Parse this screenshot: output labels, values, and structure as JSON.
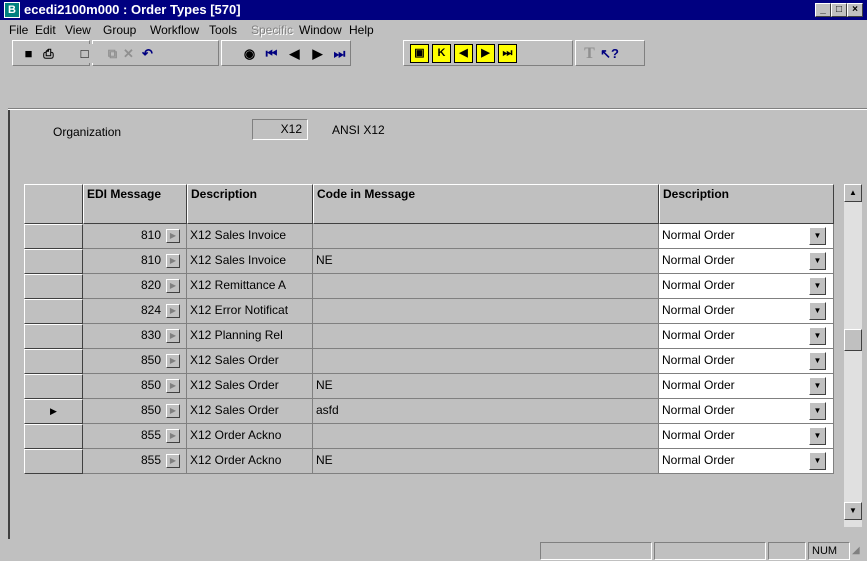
{
  "window": {
    "title": "ecedi2100m000 : Order Types [570]",
    "app_icon": "B",
    "controls": [
      "_",
      "□",
      "×"
    ]
  },
  "menu": [
    {
      "label": "File",
      "disabled": false
    },
    {
      "label": "Edit",
      "disabled": false
    },
    {
      "label": "View",
      "disabled": false
    },
    {
      "label": "Group",
      "disabled": false
    },
    {
      "label": "Workflow",
      "disabled": false
    },
    {
      "label": "Tools",
      "disabled": false
    },
    {
      "label": "Specific",
      "disabled": true
    },
    {
      "label": "Window",
      "disabled": false
    },
    {
      "label": "Help",
      "disabled": false
    }
  ],
  "toolbar": {
    "icons": [
      "save-icon",
      "print-icon",
      "new-icon",
      "copy-icon",
      "delete-icon",
      "undo-icon",
      "find-icon",
      "first-record-icon",
      "previous-record-icon",
      "next-record-icon",
      "last-record-icon",
      "first-group-icon",
      "first-set-icon",
      "previous-set-icon",
      "next-set-icon",
      "last-set-icon",
      "text-icon",
      "help-pointer-icon"
    ]
  },
  "organization": {
    "label": "Organization",
    "code": "X12",
    "description": "ANSI X12"
  },
  "grid": {
    "headers": {
      "edi_message": "EDI Message",
      "description": "Description",
      "code_in_message": "Code in Message",
      "order_description": "Description"
    },
    "rows": [
      {
        "edi": "810",
        "desc": "X12 Sales Invoice",
        "code": "",
        "order_type": "Normal Order",
        "current": false
      },
      {
        "edi": "810",
        "desc": "X12 Sales Invoice",
        "code": "NE",
        "order_type": "Normal Order",
        "current": false
      },
      {
        "edi": "820",
        "desc": "X12 Remittance A",
        "code": "",
        "order_type": "Normal Order",
        "current": false
      },
      {
        "edi": "824",
        "desc": "X12 Error Notificat",
        "code": "",
        "order_type": "Normal Order",
        "current": false
      },
      {
        "edi": "830",
        "desc": "X12 Planning Rel",
        "code": "",
        "order_type": "Normal Order",
        "current": false
      },
      {
        "edi": "850",
        "desc": "X12 Sales Order",
        "code": "",
        "order_type": "Normal Order",
        "current": false
      },
      {
        "edi": "850",
        "desc": "X12 Sales Order",
        "code": "NE",
        "order_type": "Normal Order",
        "current": false
      },
      {
        "edi": "850",
        "desc": "X12 Sales Order",
        "code": "asfd",
        "order_type": "Normal Order",
        "current": true
      },
      {
        "edi": "855",
        "desc": "X12 Order Ackno",
        "code": "",
        "order_type": "Normal Order",
        "current": false
      },
      {
        "edi": "855",
        "desc": "X12 Order Ackno",
        "code": "NE",
        "order_type": "Normal Order",
        "current": false
      }
    ]
  },
  "status": {
    "num": "NUM"
  }
}
